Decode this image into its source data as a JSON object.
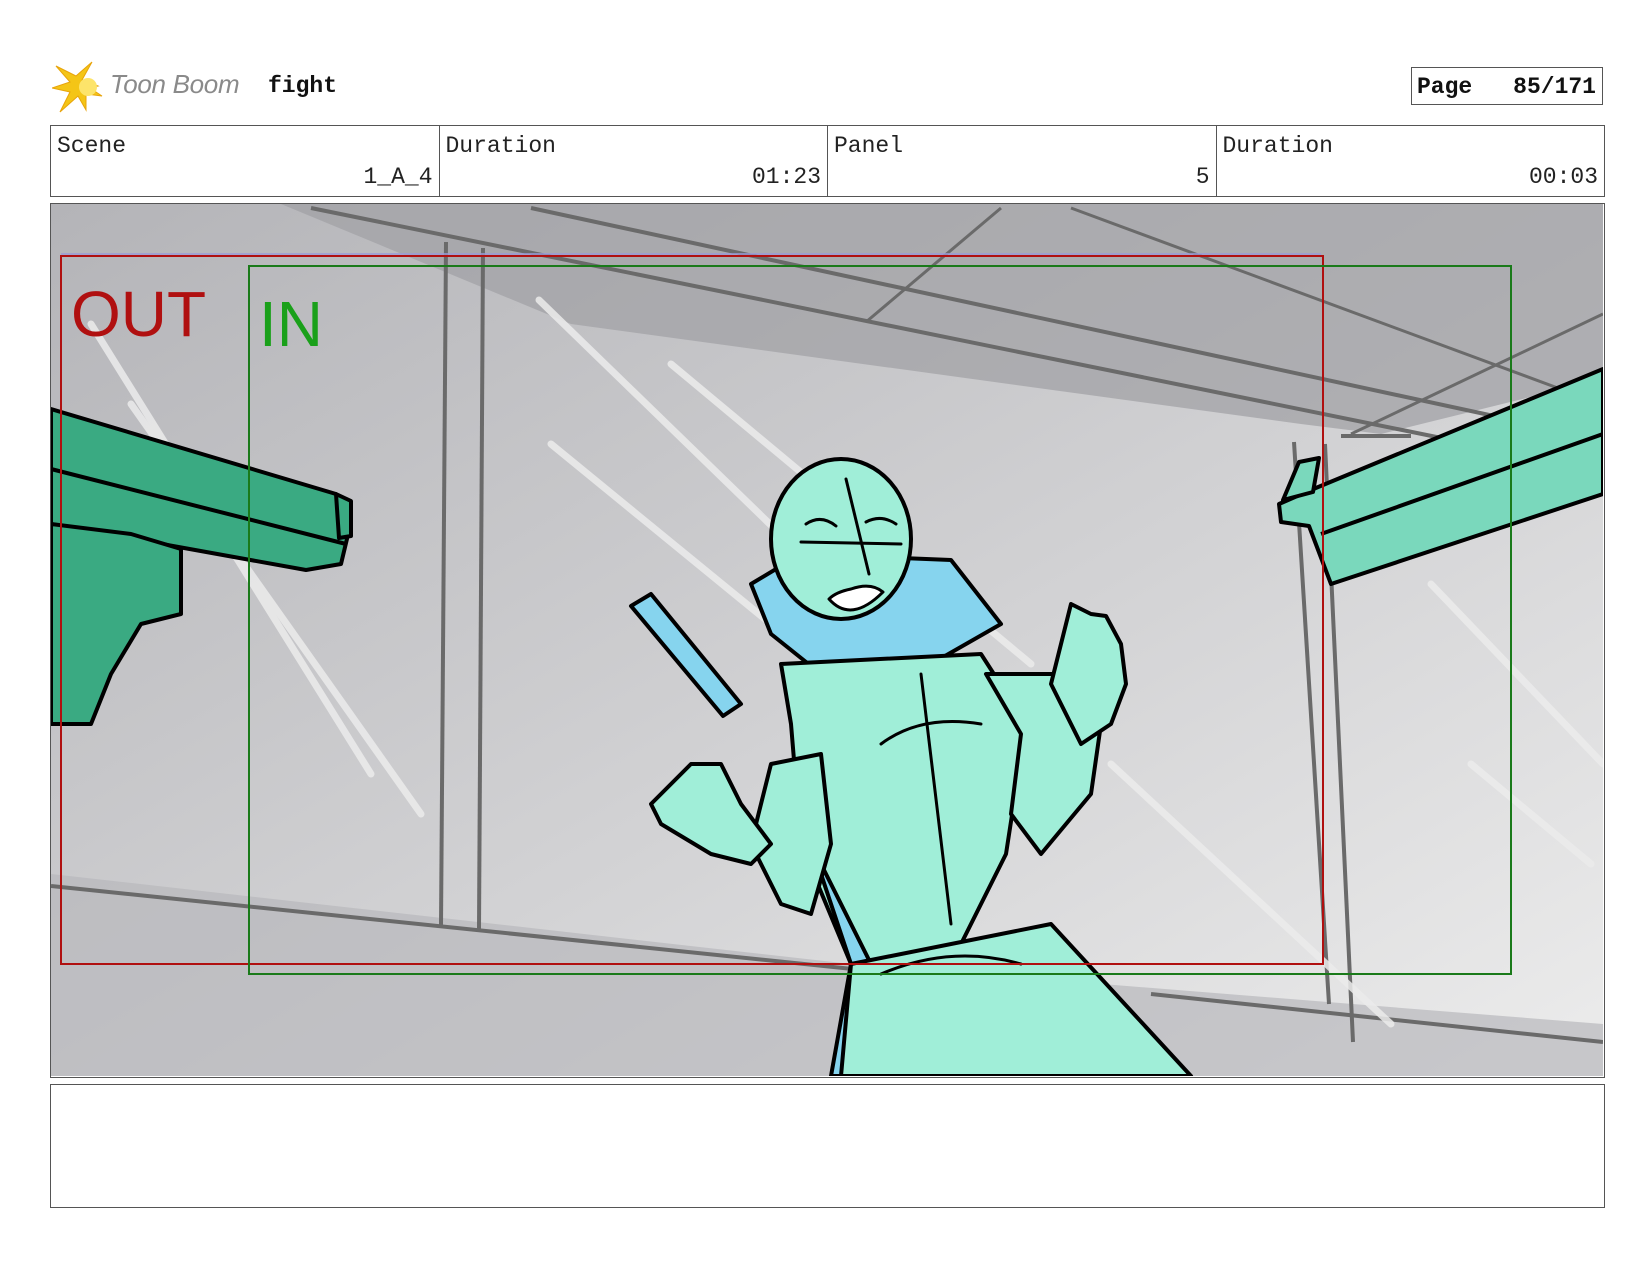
{
  "header": {
    "logo_text": "Toon Boom",
    "logo_icon": "toon-boom-star-icon",
    "project_title": "fight",
    "page_label": "Page",
    "page_value": "85/171"
  },
  "info": {
    "scene_label": "Scene",
    "scene_value": "1_A_4",
    "scene_duration_label": "Duration",
    "scene_duration_value": "01:23",
    "panel_label": "Panel",
    "panel_value": "5",
    "panel_duration_label": "Duration",
    "panel_duration_value": "00:03"
  },
  "panel": {
    "out_label": "OUT",
    "in_label": "IN",
    "colors": {
      "out_frame": "#b01010",
      "in_frame": "#1a7a1a",
      "character_body": "#a0eed8",
      "character_accent": "#86d4ee",
      "gun_left": "#3aaa82",
      "gun_right": "#7ad8bc",
      "background": "#c8c8cc"
    }
  },
  "notes": {
    "text": ""
  }
}
